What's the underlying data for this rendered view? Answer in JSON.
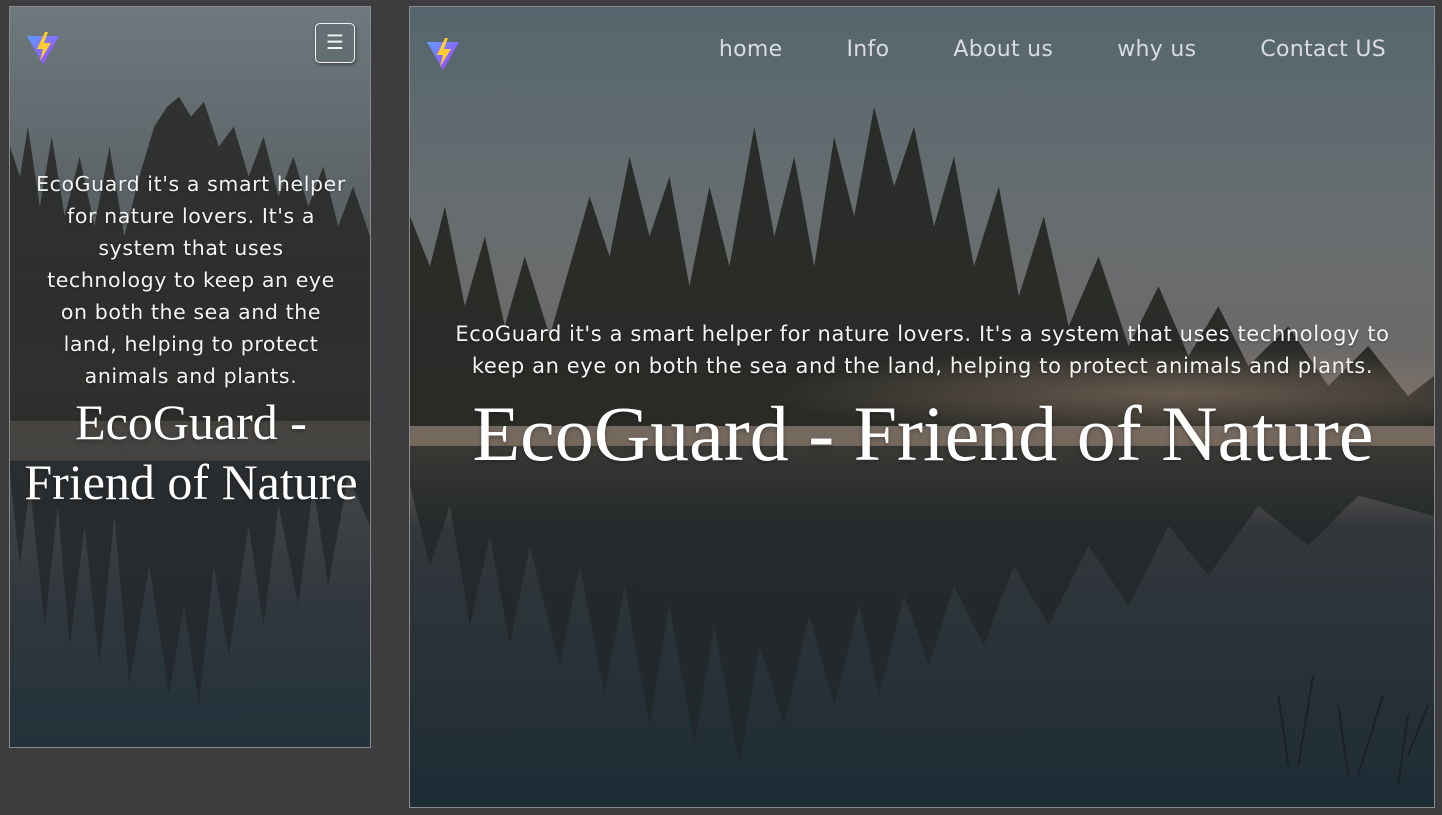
{
  "mobile": {
    "menu_button_icon": "☰",
    "tagline": "EcoGuard it's a smart helper for nature lovers. It's a system that uses technology to keep an eye on both the sea and the land, helping to protect animals and plants.",
    "headline": "EcoGuard - Friend of Nature"
  },
  "desktop": {
    "nav": [
      "home",
      "Info",
      "About us",
      "why us",
      "Contact US"
    ],
    "tagline": "EcoGuard it's a smart helper for nature lovers. It's a system that uses technology to keep an eye on both the sea and the land, helping to protect animals and plants.",
    "headline": "EcoGuard - Friend of Nature"
  },
  "icons": {
    "logo": "vite-lightning-logo-icon",
    "menu": "hamburger-menu-icon"
  },
  "colors": {
    "page_background": "#3d3c3e",
    "sky_top": "#6d7a80",
    "water_bottom": "#2a3a44",
    "logo_purple": "#8a4dff",
    "logo_yellow": "#ffcb2e",
    "text_white": "#ffffff",
    "nav_text": "#d9dcdf"
  }
}
